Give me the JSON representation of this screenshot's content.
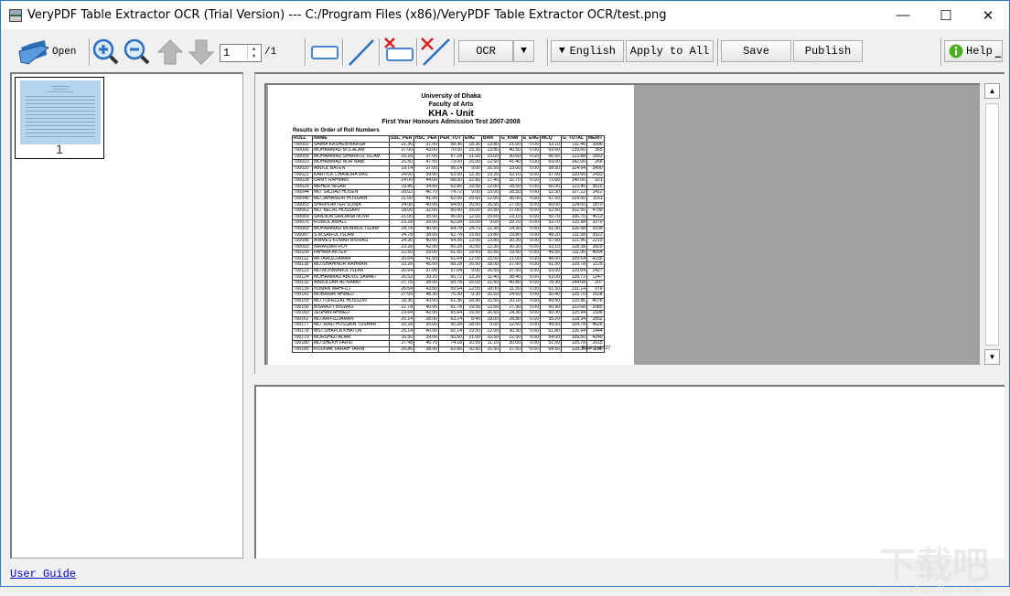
{
  "window": {
    "title": "VeryPDF Table Extractor OCR (Trial Version) --- C:/Program Files (x86)/VeryPDF Table Extractor OCR/test.png",
    "controls": {
      "minimize": "—",
      "maximize": "☐",
      "close": "✕"
    }
  },
  "toolbar": {
    "open_label": "Open",
    "page_current": "1",
    "page_total": "/1",
    "ocr_label": "OCR",
    "language_label": "English",
    "language_arrow": "▼",
    "ocr_arrow": "▼",
    "apply_all_label": "Apply to All",
    "save_label": "Save",
    "publish_label": "Publish",
    "help_label": "Help",
    "icons": [
      "folder-open-icon",
      "zoom-in-icon",
      "zoom-out-icon",
      "page-up-icon",
      "page-down-icon",
      "draw-rectangle-icon",
      "draw-line-icon",
      "delete-rectangle-icon",
      "delete-line-icon",
      "help-info-icon"
    ]
  },
  "thumbnails": [
    {
      "page_number": "1"
    }
  ],
  "document": {
    "university": "University of Dhaka",
    "faculty": "Faculty of Arts",
    "unit": "KHA - Unit",
    "test": "First Year Honours Admission Test 2007-2008",
    "subtitle": "Results in Order of Roll Numbers",
    "columns": [
      "ROLL",
      "NAME",
      "SSC_PER",
      "HSC_PER",
      "PER_TOT",
      "ENG",
      "BAN",
      "G_KNW",
      "E_ENG",
      "MCQ",
      "G_TOTAL",
      "MERIT"
    ],
    "rows": [
      [
        "700002",
        "SAIMA KASHEM BARSA",
        "21.36",
        "37.00",
        "58.36",
        "18.30",
        "13.80",
        "21.00",
        "0.00",
        "53.10",
        "111.46",
        "3996"
      ],
      [
        "700006",
        "MOHAMMAD M.S.ALAM",
        "27.00",
        "43.00",
        "70.00",
        "15.30",
        "13.80",
        "40.50",
        "0.00",
        "69.60",
        "139.60",
        "365"
      ],
      [
        "700009",
        "MOHAMMAD SHARIFUL ISLAM",
        "20.28",
        "37.00",
        "57.28",
        "21.00",
        "15.00",
        "30.60",
        "0.00",
        "66.60",
        "123.88",
        "1893"
      ],
      [
        "700010",
        "MOHAMMAD NUR NABI",
        "25.50",
        "47.50",
        "73.00",
        "15.00",
        "12.60",
        "41.40",
        "0.00",
        "69.00",
        "142.00",
        "266"
      ],
      [
        "700020",
        "ABDUL BATEN",
        "19.14",
        "37.00",
        "56.14",
        "9.00",
        "16.50",
        "33.00",
        "0.00",
        "58.50",
        "114.64",
        "3490"
      ],
      [
        "700021",
        "KARTICK CHANDRA DAS",
        "24.00",
        "39.00",
        "63.00",
        "12.30",
        "13.20",
        "32.10",
        "0.00",
        "57.60",
        "120.60",
        "2433"
      ],
      [
        "700028",
        "URMY RAHMAN",
        "24.00",
        "44.00",
        "68.00",
        "22.50",
        "17.40",
        "32.70",
        "0.00",
        "72.60",
        "140.60",
        "321"
      ],
      [
        "700029",
        "MEHER NIGAR",
        "19.86",
        "34.00",
        "53.86",
        "19.50",
        "12.00",
        "28.50",
        "0.00",
        "60.00",
        "113.86",
        "3615"
      ],
      [
        "700044",
        "MD. SAJJAD HOSEN",
        "28.02",
        "46.70",
        "74.72",
        "9.00",
        "15.00",
        "28.50",
        "0.00",
        "52.50",
        "127.22",
        "1412"
      ],
      [
        "700046",
        "MD.JAHANGIR HOSSAIN",
        "21.00",
        "41.00",
        "62.00",
        "19.50",
        "12.00",
        "36.00",
        "0.00",
        "67.50",
        "129.50",
        "1151"
      ],
      [
        "700053",
        "SHIRIN AKTER SONIA",
        "24.00",
        "40.00",
        "64.00",
        "16.50",
        "16.50",
        "27.00",
        "0.00",
        "60.00",
        "124.00",
        "1870"
      ],
      [
        "700062",
        "MD. BELAL HOSSAIN",
        "18.00",
        "32.00",
        "50.00",
        "15.00",
        "10.50",
        "27.00",
        "0.00",
        "52.50",
        "102.50",
        "4790"
      ],
      [
        "700069",
        "SANJIDA SANJANA NOVA",
        "21.00",
        "35.00",
        "56.00",
        "12.00",
        "15.60",
        "23.10",
        "0.00",
        "50.70",
        "106.70",
        "4513"
      ],
      [
        "700076",
        "ROBIUL AWALL",
        "23.28",
        "39.00",
        "62.28",
        "15.00",
        "9.00",
        "29.70",
        "0.00",
        "53.70",
        "115.98",
        "3270"
      ],
      [
        "700083",
        "MOHAMMAD MONIRUL ISLAM",
        "24.78",
        "40.00",
        "64.78",
        "14.70",
        "12.30",
        "24.90",
        "0.00",
        "51.90",
        "116.68",
        "3109"
      ],
      [
        "700087",
        "S.M.SAIFUL ISLAM",
        "24.78",
        "38.00",
        "62.78",
        "15.60",
        "13.80",
        "19.80",
        "0.00",
        "49.20",
        "111.98",
        "3923"
      ],
      [
        "700088",
        "ANIMES KUMAR BISWAS",
        "24.36",
        "40.00",
        "64.36",
        "13.50",
        "13.80",
        "30.30",
        "0.00",
        "57.60",
        "121.96",
        "2210"
      ],
      [
        "700093",
        "NIRANJAN ROY",
        "23.28",
        "42.00",
        "65.28",
        "10.50",
        "12.30",
        "30.30",
        "0.00",
        "53.10",
        "118.38",
        "2829"
      ],
      [
        "700109",
        "FAHIMA AKTER",
        "22.50",
        "39.00",
        "61.50",
        "19.50",
        "10.50",
        "19.50",
        "0.00",
        "49.50",
        "111.00",
        "4054"
      ],
      [
        "700112",
        "AKTARUZZAMAN",
        "20.64",
        "41.00",
        "61.64",
        "12.00",
        "15.00",
        "21.00",
        "0.00",
        "48.00",
        "109.64",
        "4235"
      ],
      [
        "700118",
        "MD.SHAHINUR RAHMAN",
        "23.28",
        "45.00",
        "68.28",
        "16.50",
        "18.00",
        "27.00",
        "0.00",
        "61.50",
        "129.78",
        "1125"
      ],
      [
        "700123",
        "MD.MONWARUL ISLAR",
        "20.64",
        "37.00",
        "57.64",
        "9.00",
        "16.50",
        "37.50",
        "0.00",
        "63.00",
        "120.64",
        "2427"
      ],
      [
        "700124",
        "MOHAMMAD ABDUS SAMAD",
        "26.52",
        "39.20",
        "65.72",
        "13.20",
        "11.40",
        "38.40",
        "0.00",
        "63.00",
        "128.72",
        "1247"
      ],
      [
        "700132",
        "ABDULLAH-AL-RABBI",
        "27.78",
        "38.00",
        "65.78",
        "15.00",
        "22.50",
        "40.80",
        "0.00",
        "78.30",
        "144.08",
        "207"
      ],
      [
        "700139",
        "NUMAN MAHFUJ",
        "26.64",
        "43.00",
        "69.64",
        "12.00",
        "18.00",
        "31.50",
        "0.00",
        "61.50",
        "131.14",
        "976"
      ],
      [
        "700141",
        "MUBARAK AHMED",
        "27.00",
        "48.30",
        "75.30",
        "9.30",
        "16.50",
        "24.60",
        "0.00",
        "50.40",
        "125.70",
        "1628"
      ],
      [
        "700155",
        "MD.TOFAZZAL HOSSZIN",
        "18.36",
        "43.00",
        "61.36",
        "18.90",
        "10.50",
        "20.10",
        "0.00",
        "49.50",
        "110.86",
        "4076"
      ],
      [
        "700156",
        "BISWAJIT BISWAS",
        "21.78",
        "40.00",
        "61.78",
        "19.50",
        "13.50",
        "27.90",
        "0.00",
        "60.90",
        "122.68",
        "2085"
      ],
      [
        "700160",
        "JESHAN AHMED",
        "23.64",
        "42.00",
        "65.64",
        "19.50",
        "16.50",
        "24.30",
        "0.00",
        "60.30",
        "125.94",
        "1596"
      ],
      [
        "700162",
        "MD.ARIFUJJAMAN",
        "25.14",
        "38.00",
        "63.14",
        "8.40",
        "18.00",
        "28.80",
        "0.00",
        "55.20",
        "118.34",
        "2852"
      ],
      [
        "700177",
        "MD. RIAD HOSSAIN TUSHAR",
        "20.28",
        "35.00",
        "55.28",
        "18.00",
        "9.00",
        "22.50",
        "0.00",
        "49.50",
        "104.78",
        "4626"
      ],
      [
        "700178",
        "MST.SHAPLA KHATUN",
        "25.14",
        "40.00",
        "65.14",
        "19.50",
        "12.00",
        "30.30",
        "0.00",
        "61.80",
        "126.94",
        "1444"
      ],
      [
        "700179",
        "MORSHED ALAM",
        "16.50",
        "39.00",
        "55.50",
        "21.00",
        "10.50",
        "22.50",
        "0.00",
        "54.00",
        "109.50",
        "4240"
      ],
      [
        "700180",
        "MD.SHEKH FARID",
        "27.48",
        "46.70",
        "74.18",
        "10.50",
        "11.10",
        "30.00",
        "0.00",
        "51.60",
        "125.78",
        "1615"
      ],
      [
        "700185",
        "ROUNAK FARAH TARIN",
        "25.86",
        "38.00",
        "63.86",
        "10.50",
        "16.50",
        "37.50",
        "0.00",
        "64.50",
        "128.36",
        "1289"
      ]
    ],
    "page_footer": "Page 1 of 127"
  },
  "footer": {
    "user_guide_label": "User Guide"
  },
  "watermark": {
    "main": "下载吧",
    "url": "www.xiazaiba.com"
  }
}
